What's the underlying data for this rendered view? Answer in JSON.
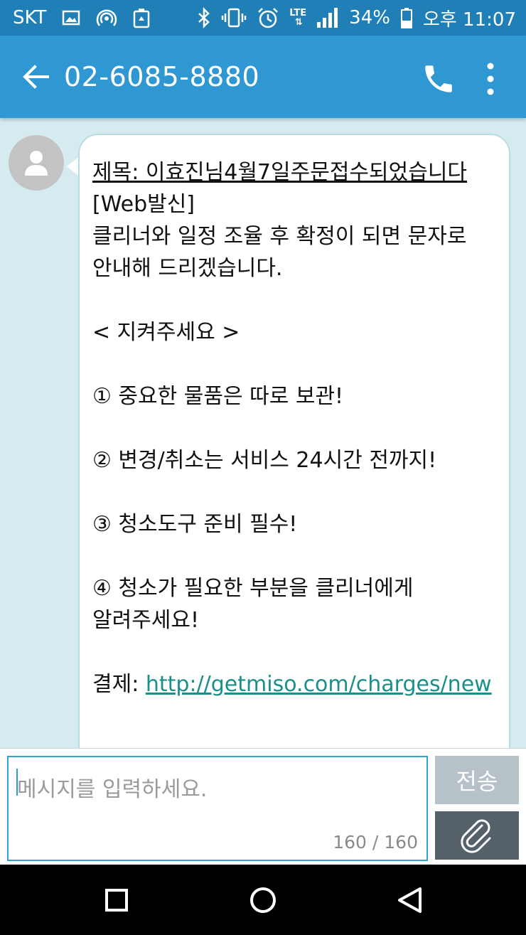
{
  "status_bar": {
    "carrier": "SKT",
    "network": "LTE",
    "battery": "34%",
    "time": "오후 11:07",
    "icons": [
      "gallery-icon",
      "hotspot-icon",
      "recycle-icon",
      "bluetooth-icon",
      "vibrate-icon",
      "alarm-icon",
      "lte-arrows-icon",
      "signal-icon",
      "battery-icon"
    ]
  },
  "app_bar": {
    "title": "02-6085-8880",
    "back_icon": "arrow-left-icon",
    "call_icon": "phone-icon",
    "menu_icon": "more-vert-icon"
  },
  "message": {
    "subject": "제목: 이효진님4월7일주문접수되었습니다",
    "body_lines": [
      "[Web발신]",
      "클리너와 일정 조율 후 확정이 되면 문자로 안내해 드리겠습니다.",
      "",
      "< 지켜주세요 >",
      "",
      "① 중요한 물품은 따로 보관!",
      "",
      "② 변경/취소는 서비스 24시간 전까지!",
      "",
      "③ 청소도구 준비 필수!",
      "",
      "④ 청소가 필요한 부분을 클리너에게 알려주세요!",
      ""
    ],
    "payment_label": "결제: ",
    "payment_link": "http://getmiso.com/charges/new"
  },
  "compose": {
    "placeholder": "메시지를 입력하세요.",
    "char_count": "160 / 160",
    "send_label": "전송",
    "attach_icon": "paperclip-icon"
  },
  "nav_bar": {
    "icons": [
      "recent-apps-icon",
      "home-icon",
      "back-icon"
    ]
  },
  "colors": {
    "status_bar": "#1f7fb6",
    "app_bar": "#2f97d1",
    "background": "#d6ebef",
    "link": "#1b8f8a",
    "send_button": "#b7c2c8",
    "attach_button": "#546169"
  }
}
